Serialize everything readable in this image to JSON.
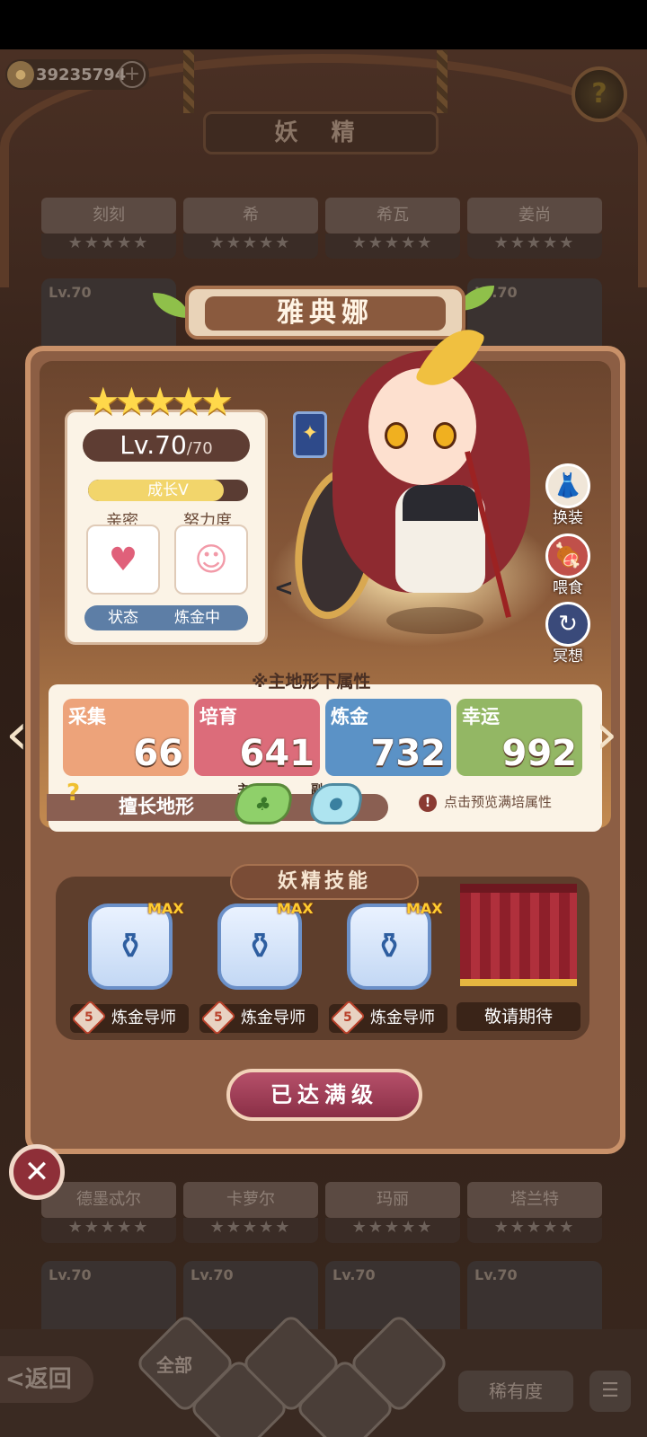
{
  "header": {
    "title": "妖 精",
    "currency_value": "39235794",
    "currency_add": "+",
    "help": "?"
  },
  "roster_top": [
    {
      "name": "刻刻",
      "stars": "★★★★★"
    },
    {
      "name": "希",
      "stars": "★★★★★"
    },
    {
      "name": "希瓦",
      "stars": "★★★★★"
    },
    {
      "name": "姜尚",
      "stars": "★★★★★"
    }
  ],
  "roster_lv_top": [
    "Lv.70",
    "Lv.70"
  ],
  "fairy": {
    "name": "雅典娜",
    "stars": "★★★★★",
    "level": "Lv.70",
    "level_max": "/70",
    "growth_label": "成长V",
    "growth_fraction": 0.85,
    "intimacy_label": "亲密",
    "intimacy_icon": "♥",
    "effort_label": "努力度",
    "effort_icon": "☺",
    "status_label": "状态",
    "status_value": "炼金中"
  },
  "side_actions": [
    {
      "label": "换装",
      "icon": "👗"
    },
    {
      "label": "喂食",
      "icon": "🍖"
    },
    {
      "label": "冥想",
      "icon": "↻"
    }
  ],
  "attributes": {
    "note": "※主地形下属性",
    "items": [
      {
        "name": "采集",
        "value": "66",
        "color": "#eda37a"
      },
      {
        "name": "培育",
        "value": "641",
        "color": "#dc6c7a"
      },
      {
        "name": "炼金",
        "value": "732",
        "color": "#5b92c6"
      },
      {
        "name": "幸运",
        "value": "992",
        "color": "#93b764"
      }
    ],
    "terrain_label": "擅长地形",
    "main_tag": "主",
    "sub_tag": "副",
    "preview": "点击预览满培属性",
    "preview_icon": "!"
  },
  "skills": {
    "title": "妖精技能",
    "max_badge": "MAX",
    "items": [
      {
        "level": "5",
        "label": "炼金导师"
      },
      {
        "level": "5",
        "label": "炼金导师"
      },
      {
        "level": "5",
        "label": "炼金导师"
      }
    ],
    "coming_soon": "敬请期待"
  },
  "maxed_button": "已达满级",
  "roster_bottom": [
    {
      "name": "德墨忒尔",
      "stars": "★★★★★"
    },
    {
      "name": "卡萝尔",
      "stars": "★★★★★"
    },
    {
      "name": "玛丽",
      "stars": "★★★★★"
    },
    {
      "name": "塔兰特",
      "stars": "★★★★★"
    }
  ],
  "roster_lv_bottom": [
    "Lv.70",
    "Lv.70",
    "Lv.70",
    "Lv.70"
  ],
  "bottom_nav": {
    "back": "<返回",
    "all": "全部",
    "rarity": "稀有度",
    "sort_icon": "☰"
  }
}
